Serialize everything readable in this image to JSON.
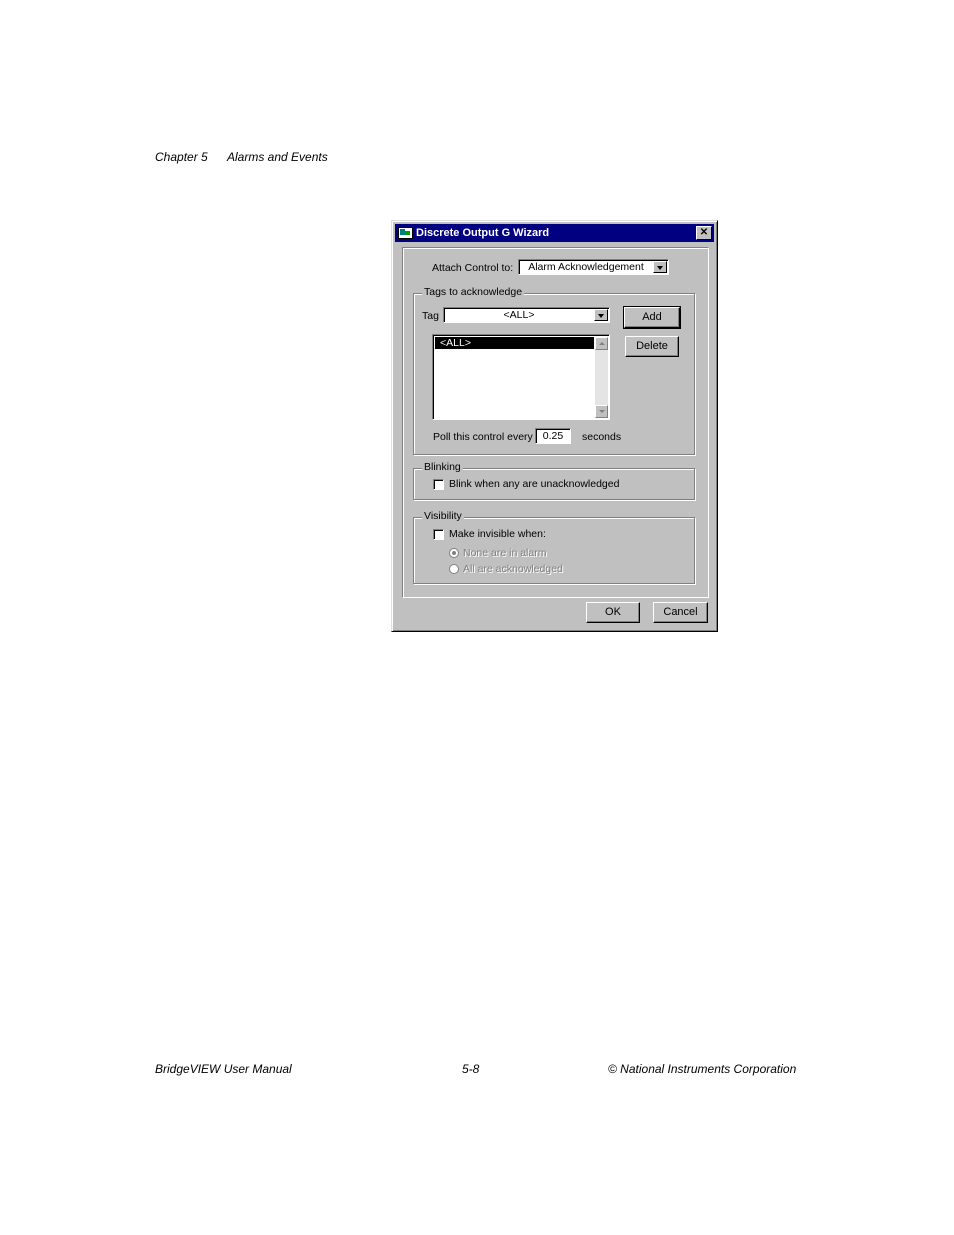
{
  "page": {
    "header": {
      "chapter": "Chapter 5",
      "section": "Alarms and Events"
    },
    "footer": {
      "manual": "BridgeVIEW User Manual",
      "page_number": "5-8",
      "copyright": "© National Instruments Corporation"
    }
  },
  "dialog": {
    "title": "Discrete Output G Wizard",
    "close_symbol": "✕",
    "attach": {
      "label": "Attach Control to:",
      "value": "Alarm Acknowledgement"
    },
    "tags_group": {
      "title": "Tags to acknowledge",
      "tag_label": "Tag",
      "tag_value": "<ALL>",
      "add_label": "Add",
      "delete_label": "Delete",
      "list_items": [
        "<ALL>"
      ],
      "poll_label": "Poll this control every",
      "poll_value": "0.25",
      "poll_unit": "seconds"
    },
    "blinking_group": {
      "title": "Blinking",
      "checkbox_label": "Blink when any are unacknowledged",
      "checked": false
    },
    "visibility_group": {
      "title": "Visibility",
      "checkbox_label": "Make invisible when:",
      "checked": false,
      "options": [
        "None are in alarm",
        "All are acknowledged"
      ],
      "selected_option": 0
    },
    "ok_label": "OK",
    "cancel_label": "Cancel"
  },
  "icons": [
    "app-icon",
    "close-icon",
    "dropdown-arrow-icon",
    "scroll-up-icon",
    "scroll-down-icon"
  ]
}
